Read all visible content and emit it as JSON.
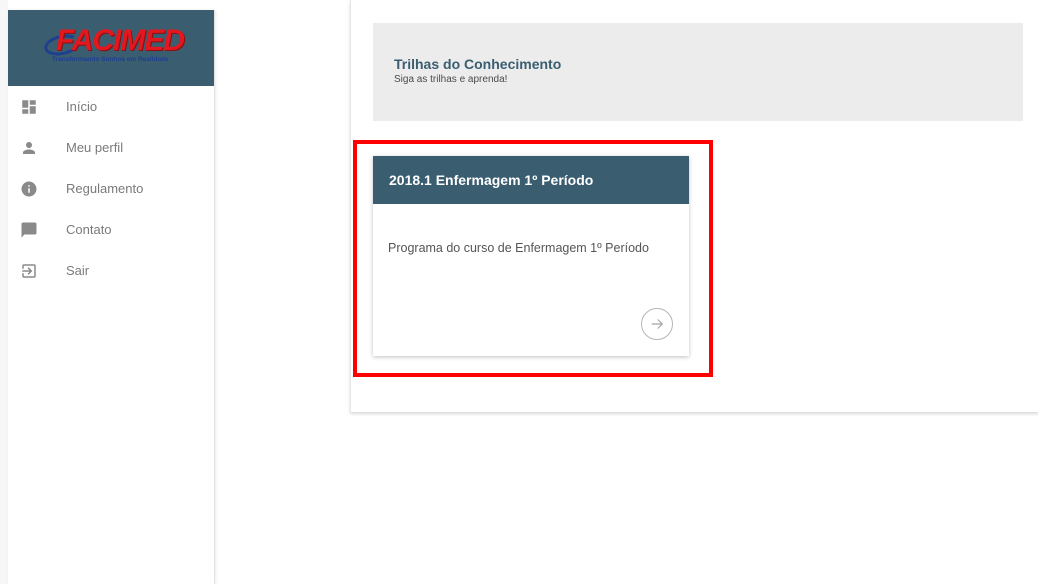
{
  "brand": {
    "logo_text": "FACIMED",
    "tagline": "Transformando Sonhos em Realidade"
  },
  "sidebar": {
    "items": [
      {
        "label": "Início",
        "icon": "dashboard-icon"
      },
      {
        "label": "Meu perfil",
        "icon": "person-icon"
      },
      {
        "label": "Regulamento",
        "icon": "info-icon"
      },
      {
        "label": "Contato",
        "icon": "chat-icon"
      },
      {
        "label": "Sair",
        "icon": "exit-icon"
      }
    ]
  },
  "header": {
    "title": "Trilhas do Conhecimento",
    "subtitle": "Siga as trilhas e aprenda!"
  },
  "card": {
    "title": "2018.1 Enfermagem 1º Período",
    "description": "Programa do curso de Enfermagem 1º Período",
    "action_icon": "arrow-right-circle-icon"
  },
  "colors": {
    "brand_bar": "#3a5d70",
    "logo_red": "#e3171d",
    "highlight": "#ff0000",
    "header_bg": "#ececec"
  }
}
